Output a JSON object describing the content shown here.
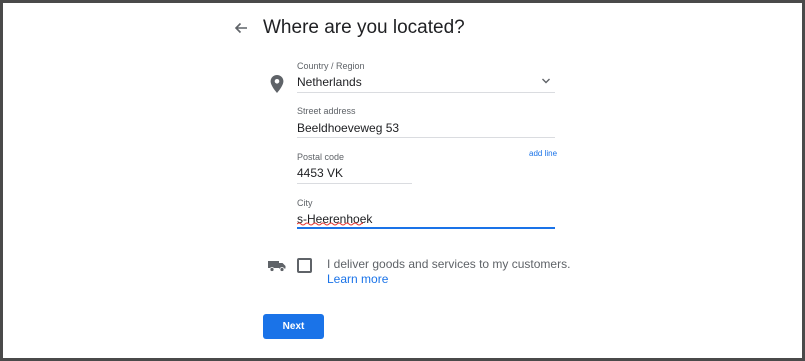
{
  "page": {
    "title": "Where are you located?"
  },
  "form": {
    "country": {
      "label": "Country / Region",
      "value": "Netherlands"
    },
    "street": {
      "label": "Street address",
      "value": "Beeldhoeveweg 53"
    },
    "add_line": "add line",
    "postal": {
      "label": "Postal code",
      "value": "4453 VK"
    },
    "city": {
      "label": "City",
      "value": "s-Heerenhoek"
    }
  },
  "delivery": {
    "checkbox_label": "I deliver goods and services to my customers.",
    "learn_more": "Learn more",
    "checked": false
  },
  "actions": {
    "next_label": "Next"
  },
  "icons": {
    "back": "arrow-back-icon",
    "location": "location-pin-icon",
    "dropdown": "chevron-down-icon",
    "delivery": "truck-icon"
  },
  "colors": {
    "accent": "#1a73e8",
    "text": "#202124",
    "secondary_text": "#5f6368",
    "divider": "#dadce0",
    "frame": "#4a4a4a"
  }
}
